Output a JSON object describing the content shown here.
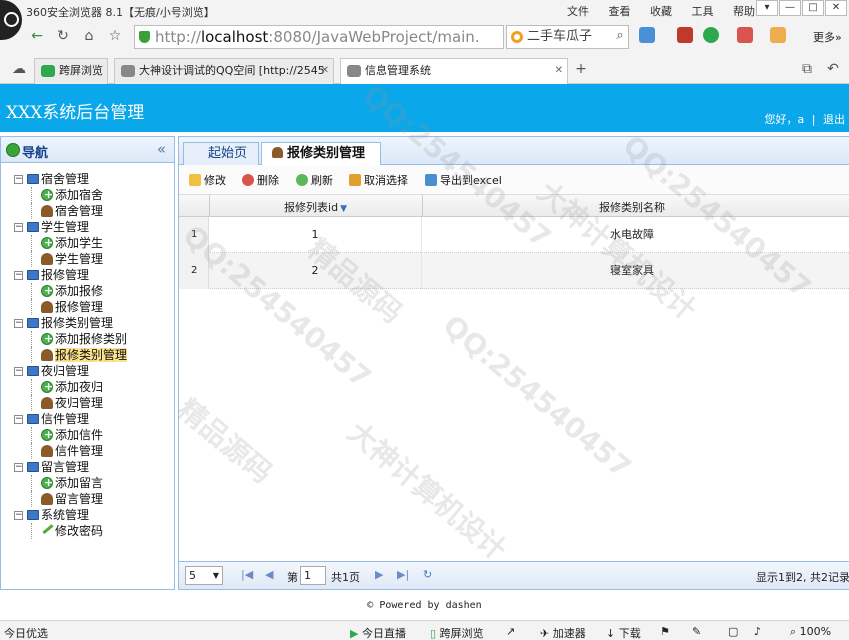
{
  "browser": {
    "title": "360安全浏览器 8.1【无痕/小号浏览】",
    "menus": [
      "文件",
      "查看",
      "收藏",
      "工具",
      "帮助"
    ],
    "address": {
      "scheme": "http://",
      "host": "localhost",
      "rest": ":8080/JavaWebProject/main."
    },
    "search_value": "二手车瓜子",
    "more_label": "更多»",
    "tabs": [
      {
        "label": "跨屏浏览"
      },
      {
        "label": "大神设计调试的QQ空间 [http://2545"
      },
      {
        "label": "信息管理系统"
      }
    ],
    "new_tab": "+"
  },
  "header": {
    "system_title": "XXX系统后台管理",
    "greeting": "您好，a",
    "separator": "|",
    "logout": "退出"
  },
  "sidebar": {
    "title": "导航",
    "collapse": "«",
    "groups": [
      {
        "label": "宿舍管理",
        "items": [
          {
            "label": "添加宿舍",
            "icon": "add-icon"
          },
          {
            "label": "宿舍管理",
            "icon": "user-icon"
          }
        ]
      },
      {
        "label": "学生管理",
        "items": [
          {
            "label": "添加学生",
            "icon": "add-icon"
          },
          {
            "label": "学生管理",
            "icon": "user-icon"
          }
        ]
      },
      {
        "label": "报修管理",
        "items": [
          {
            "label": "添加报修",
            "icon": "add-icon"
          },
          {
            "label": "报修管理",
            "icon": "user-icon"
          }
        ]
      },
      {
        "label": "报修类别管理",
        "items": [
          {
            "label": "添加报修类别",
            "icon": "add-icon"
          },
          {
            "label": "报修类别管理",
            "icon": "user-icon",
            "selected": true
          }
        ]
      },
      {
        "label": "夜归管理",
        "items": [
          {
            "label": "添加夜归",
            "icon": "add-icon"
          },
          {
            "label": "夜归管理",
            "icon": "user-icon"
          }
        ]
      },
      {
        "label": "信件管理",
        "items": [
          {
            "label": "添加信件",
            "icon": "add-icon"
          },
          {
            "label": "信件管理",
            "icon": "user-icon"
          }
        ]
      },
      {
        "label": "留言管理",
        "items": [
          {
            "label": "添加留言",
            "icon": "add-icon"
          },
          {
            "label": "留言管理",
            "icon": "user-icon"
          }
        ]
      },
      {
        "label": "系统管理",
        "items": [
          {
            "label": "修改密码",
            "icon": "pencil-icon"
          }
        ]
      }
    ]
  },
  "main": {
    "tabs": [
      {
        "label": "起始页"
      },
      {
        "label": "报修类别管理",
        "close": "×"
      }
    ],
    "toolbar": {
      "edit": "修改",
      "delete": "删除",
      "refresh": "刷新",
      "cancel_select": "取消选择",
      "export": "导出到excel"
    },
    "grid": {
      "columns": [
        "报修列表id",
        "报修类别名称"
      ],
      "sort_indicator": "▼",
      "rows": [
        {
          "row_num": "1",
          "id": "1",
          "name": "水电故障"
        },
        {
          "row_num": "2",
          "id": "2",
          "name": "寝室家具"
        }
      ]
    },
    "pager": {
      "page_size": "5",
      "page_prefix": "第",
      "page_value": "1",
      "page_total": "共1页",
      "summary": "显示1到2, 共2记录"
    }
  },
  "footer": "© Powered by dashen",
  "statusbar": {
    "left": "今日优选",
    "live": "今日直播",
    "cross": "跨屏浏览",
    "accel": "加速器",
    "download": "下载",
    "zoom": "100%"
  },
  "watermarks": {
    "qq": "QQ:254540457",
    "dashen": "大神计算机设计",
    "jingpin": "精品源码"
  }
}
